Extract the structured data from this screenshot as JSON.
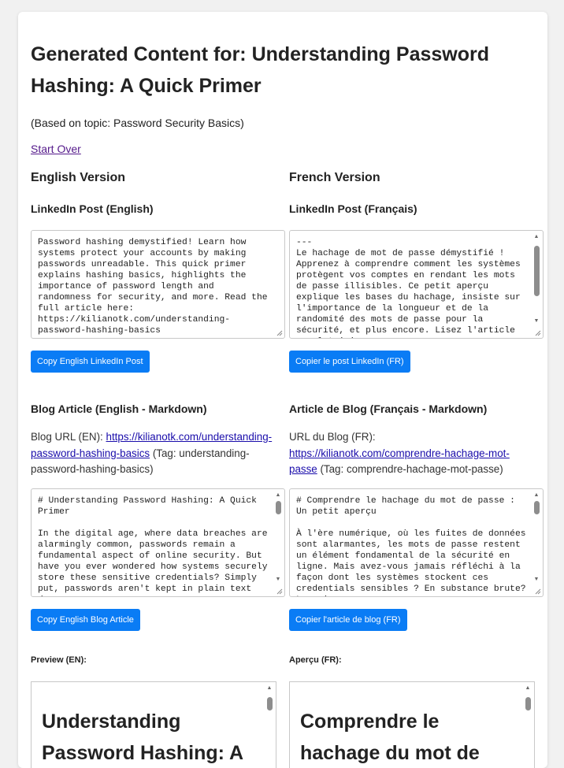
{
  "page": {
    "title": "Generated Content for: Understanding Password Hashing: A Quick Primer",
    "subtitle": "(Based on topic: Password Security Basics)",
    "start_over": "Start Over"
  },
  "english": {
    "heading": "English Version",
    "linkedin_heading": "LinkedIn Post (English)",
    "linkedin_text": "Password hashing demystified! Learn how systems protect your accounts by making passwords unreadable. This quick primer explains hashing basics, highlights the importance of password length and randomness for security, and more. Read the full article here: https://kilianotk.com/understanding-password-hashing-basics",
    "linkedin_button": "Copy English LinkedIn Post",
    "blog_heading": "Blog Article (English - Markdown)",
    "blog_url_label": "Blog URL (EN): ",
    "blog_url": "https://kilianotk.com/understanding-password-hashing-basics",
    "blog_tag": " (Tag: understanding-password-hashing-basics)",
    "blog_text": "# Understanding Password Hashing: A Quick Primer\n\nIn the digital age, where data breaches are alarmingly common, passwords remain a fundamental aspect of online security. But have you ever wondered how systems securely store these sensitive credentials? Simply put, passwords aren't kept in plain text due",
    "blog_button": "Copy English Blog Article",
    "preview_label": "Preview (EN):",
    "preview_title": "Understanding Password Hashing: A Quick Primer"
  },
  "french": {
    "heading": "French Version",
    "linkedin_heading": "LinkedIn Post (Français)",
    "linkedin_text": "---\nLe hachage de mot de passe démystifié ! Apprenez à comprendre comment les systèmes protègent vos comptes en rendant les mots de passe illisibles. Ce petit aperçu explique les bases du hachage, insiste sur l'importance de la longueur et de la randomité des mots de passe pour la sécurité, et plus encore. Lisez l'article complet ici :",
    "linkedin_button": "Copier le post LinkedIn (FR)",
    "blog_heading": "Article de Blog (Français - Markdown)",
    "blog_url_label": "URL du Blog (FR): ",
    "blog_url": "https://kilianotk.com/comprendre-hachage-mot-passe",
    "blog_tag": " (Tag: comprendre-hachage-mot-passe)",
    "blog_text": "# Comprendre le hachage du mot de passe : Un petit aperçu\n\nÀ l'ère numérique, où les fuites de données sont alarmantes, les mots de passe restent un élément fondamental de la sécurité en ligne. Mais avez-vous jamais réfléchi à la façon dont les systèmes stockent ces credentials sensibles ? En substance brute? Les risques",
    "blog_button": "Copier l'article de blog (FR)",
    "preview_label": "Aperçu (FR):",
    "preview_title": "Comprendre le hachage du mot de passe"
  }
}
